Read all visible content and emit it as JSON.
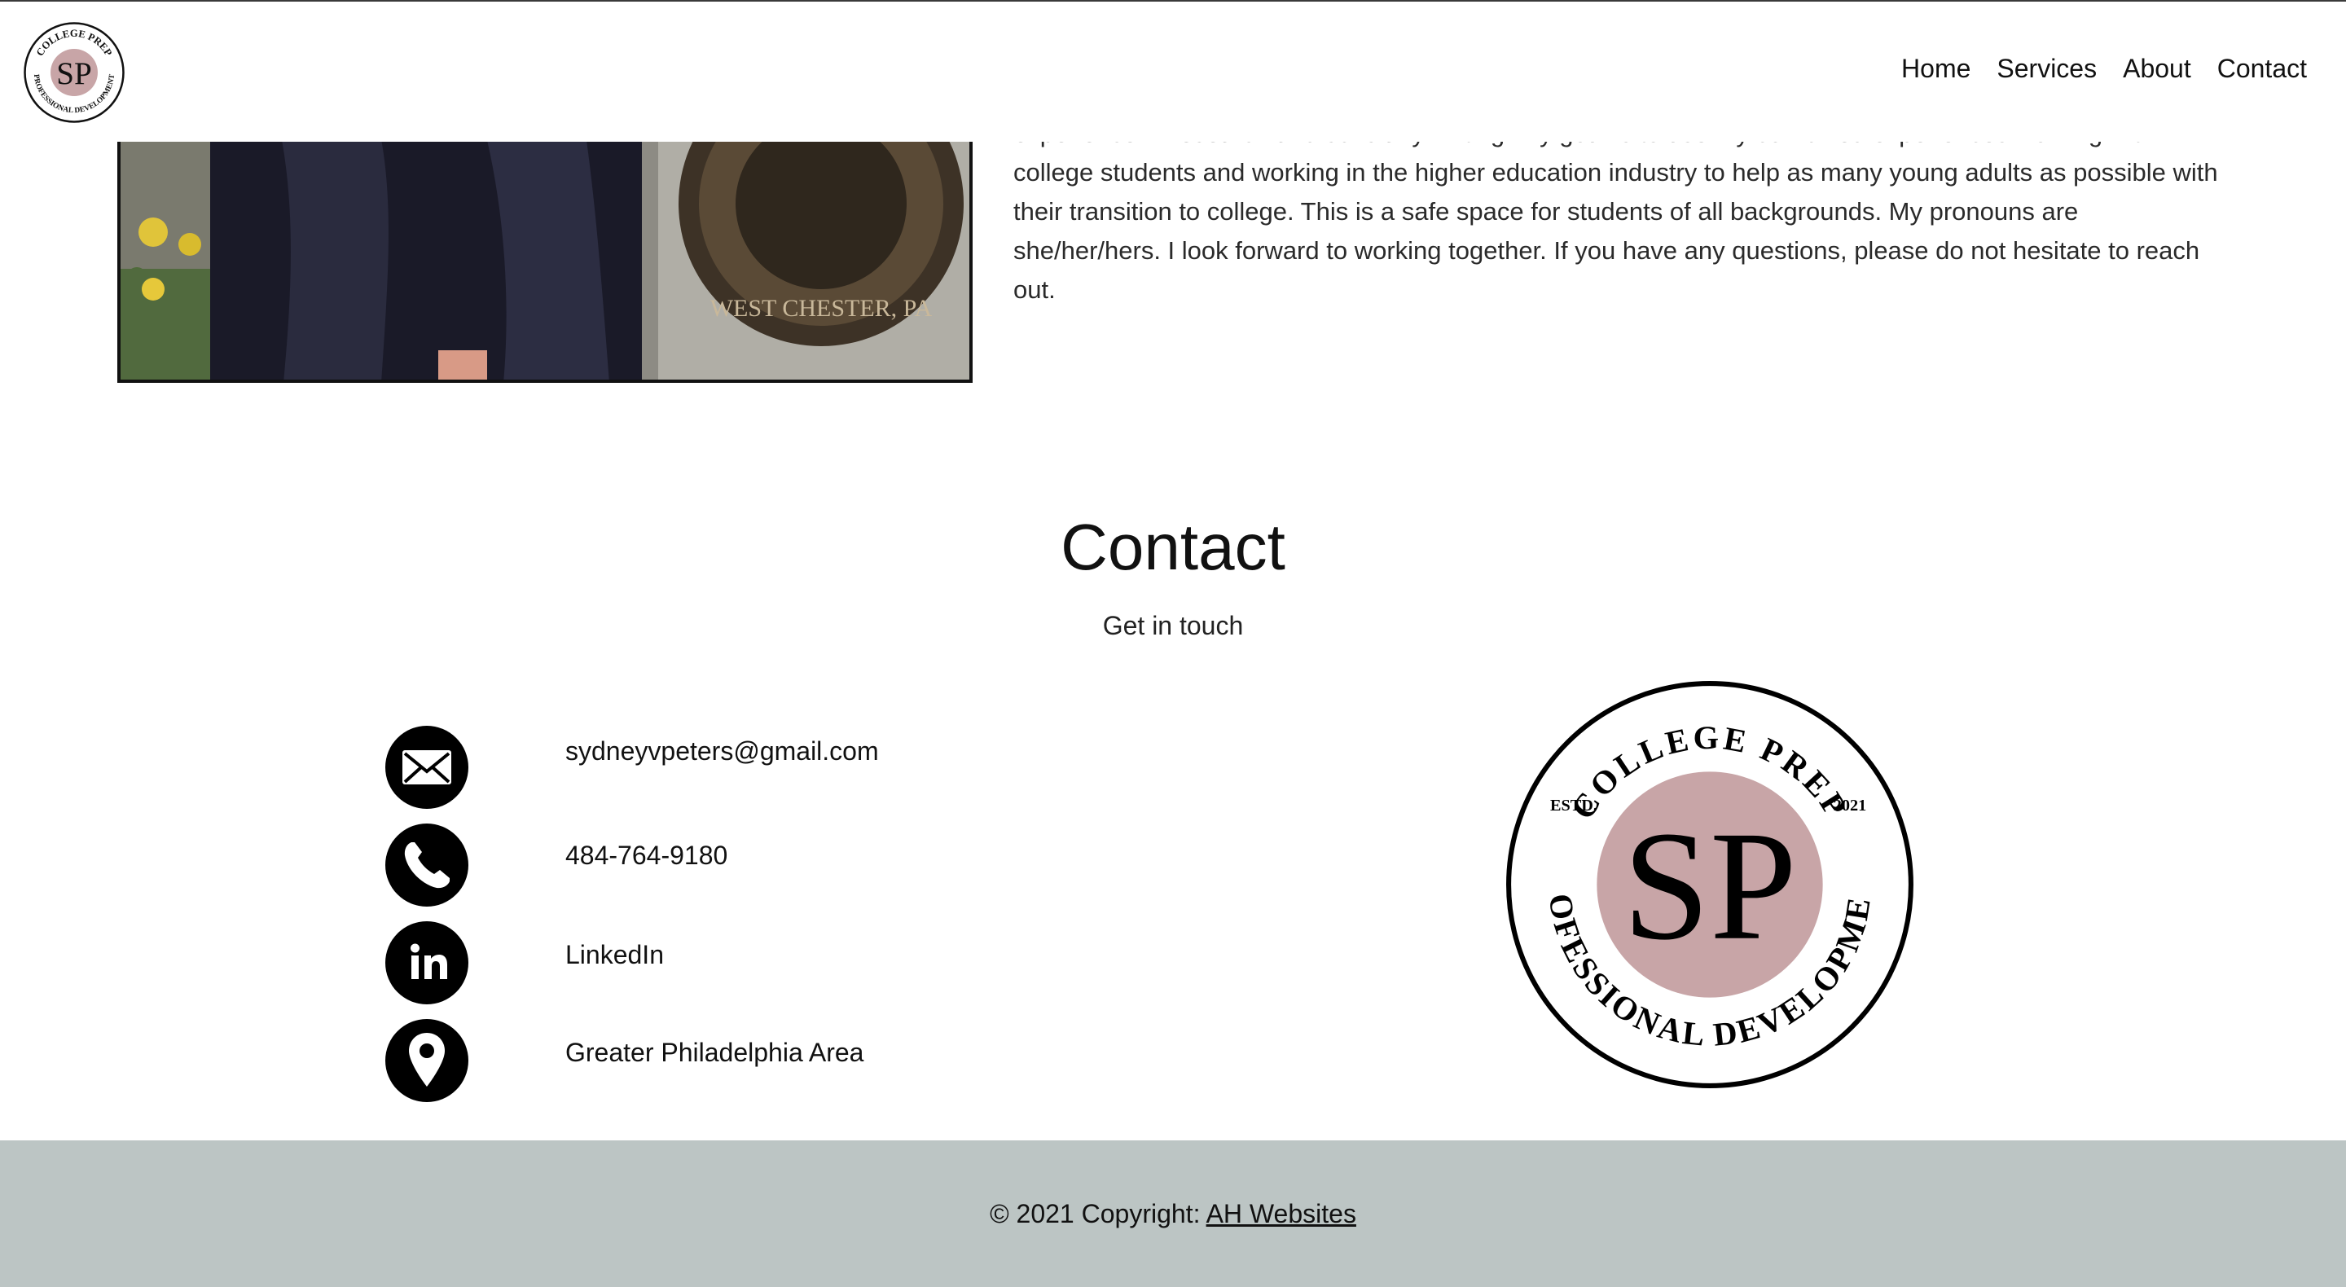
{
  "header": {
    "logo": {
      "arc_top": "COLLEGE PREP",
      "arc_bottom": "PROFESSIONAL DEVELOPMENT",
      "monogram": "SP"
    },
    "nav": [
      {
        "label": "Home"
      },
      {
        "label": "Services"
      },
      {
        "label": "About"
      },
      {
        "label": "Contact"
      }
    ]
  },
  "about": {
    "text": "experience in research and scholarly writing. My goal is to use my combined experiences working with college students and working in the higher education industry to help as many young adults as possible with their transition to college. This is a safe space for students of all backgrounds. My pronouns are she/her/hers. I look forward to working together. If you have any questions, please do not hesitate to reach out.",
    "photo_seal_text": "WEST CHESTER, PA"
  },
  "contact": {
    "title": "Contact",
    "subtitle": "Get in touch",
    "items": [
      {
        "icon": "envelope-icon",
        "value": "sydneyvpeters@gmail.com"
      },
      {
        "icon": "phone-icon",
        "value": "484-764-9180"
      },
      {
        "icon": "linkedin-icon",
        "value": "LinkedIn"
      },
      {
        "icon": "map-pin-icon",
        "value": "Greater Philadelphia Area"
      }
    ],
    "logo": {
      "arc_top": "COLLEGE PREP",
      "arc_bottom": "PROFESSIONAL DEVELOPMENT",
      "left_text": "ESTD.",
      "right_text": "2021",
      "monogram": "SP"
    }
  },
  "footer": {
    "copyright": "© 2021 Copyright: ",
    "link_label": "AH Websites"
  },
  "colors": {
    "accent_pink": "#c8a5a7",
    "footer_bg": "#bcc5c4",
    "icon_black": "#000000"
  }
}
